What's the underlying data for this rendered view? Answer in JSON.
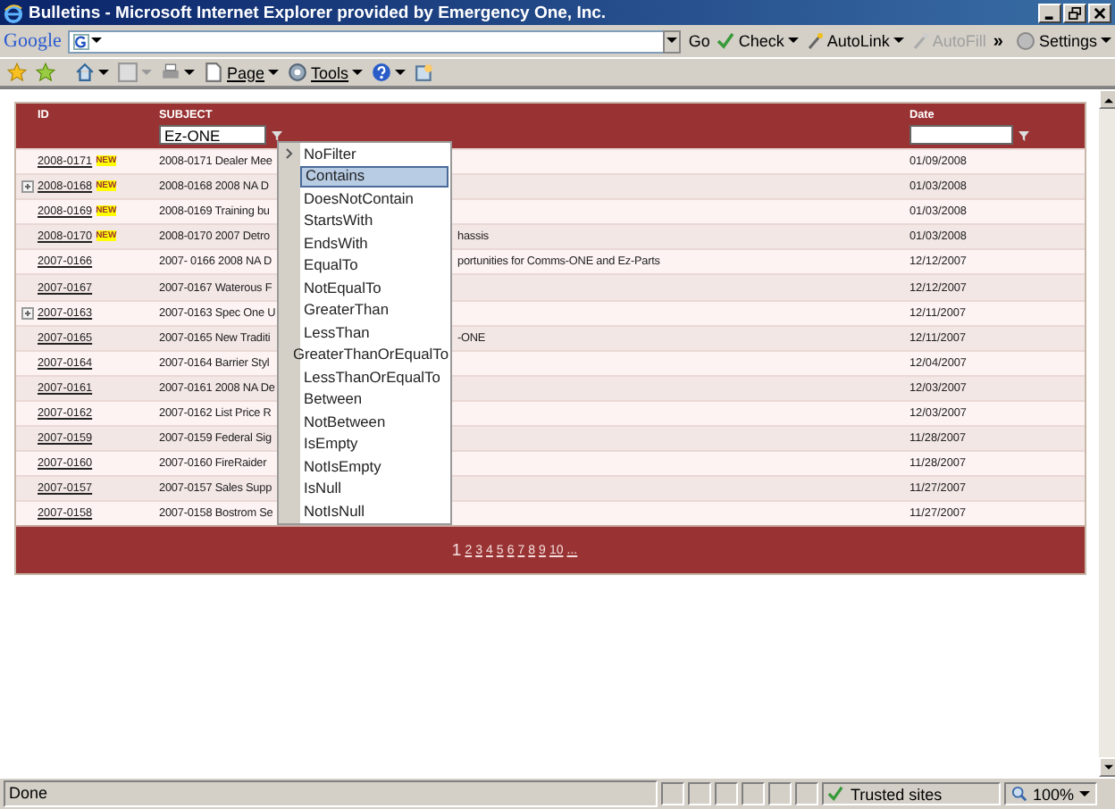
{
  "window": {
    "title": "Bulletins - Microsoft Internet Explorer provided by Emergency One, Inc."
  },
  "google_toolbar": {
    "logo": "Google",
    "go": "Go",
    "items": [
      {
        "label": "Check",
        "disabled": false,
        "dropdown": true
      },
      {
        "label": "AutoLink",
        "disabled": false,
        "dropdown": true
      },
      {
        "label": "AutoFill",
        "disabled": true,
        "dropdown": false
      }
    ],
    "more": "»",
    "settings": "Settings"
  },
  "command_bar": {
    "items": [
      {
        "label": "Page"
      },
      {
        "label": "Tools"
      }
    ]
  },
  "table": {
    "columns": [
      "ID",
      "SUBJECT",
      "Date"
    ],
    "subject_filter": "Ez-ONE",
    "rows": [
      {
        "id": "2008-0171",
        "badge": "NEW",
        "expandable": false,
        "subject": "2008-0171 Dealer Mee",
        "date": "01/09/2008"
      },
      {
        "id": "2008-0168",
        "badge": "NEW",
        "expandable": true,
        "subject": "2008-0168 2008 NA D",
        "date": "01/03/2008"
      },
      {
        "id": "2008-0169",
        "badge": "NEW",
        "expandable": false,
        "subject": "2008-0169 Training bu",
        "date": "01/03/2008"
      },
      {
        "id": "2008-0170",
        "badge": "NEW",
        "expandable": false,
        "subject": "2008-0170 2007 Detro",
        "subject_tail": "hassis",
        "date": "01/03/2008"
      },
      {
        "id": "2007-0166",
        "expandable": false,
        "subject": "2007- 0166 2008 NA D",
        "subject_tail": "portunities for Comms-ONE and Ez-Parts",
        "date": "12/12/2007"
      },
      {
        "id": "2007-0167",
        "expandable": false,
        "subject": "2007-0167 Waterous F",
        "date": "12/12/2007"
      },
      {
        "id": "2007-0163",
        "expandable": true,
        "subject": "2007-0163 Spec One U",
        "date": "12/11/2007"
      },
      {
        "id": "2007-0165",
        "expandable": false,
        "subject": "2007-0165 New Traditi",
        "subject_tail": "-ONE",
        "date": "12/11/2007"
      },
      {
        "id": "2007-0164",
        "expandable": false,
        "subject": "2007-0164 Barrier Styl",
        "date": "12/04/2007"
      },
      {
        "id": "2007-0161",
        "expandable": false,
        "subject": "2007-0161 2008 NA De",
        "date": "12/03/2007"
      },
      {
        "id": "2007-0162",
        "expandable": false,
        "subject": "2007-0162 List Price R",
        "date": "12/03/2007"
      },
      {
        "id": "2007-0159",
        "expandable": false,
        "subject": "2007-0159 Federal Sig",
        "date": "11/28/2007"
      },
      {
        "id": "2007-0160",
        "expandable": false,
        "subject": "2007-0160 FireRaider",
        "date": "11/28/2007"
      },
      {
        "id": "2007-0157",
        "expandable": false,
        "subject": "2007-0157 Sales Supp",
        "date": "11/27/2007"
      },
      {
        "id": "2007-0158",
        "expandable": false,
        "subject": "2007-0158 Bostrom Se",
        "date": "11/27/2007"
      }
    ],
    "pages": [
      {
        "label": "1",
        "selected": true
      },
      {
        "label": "2",
        "selected": false
      },
      {
        "label": "3",
        "selected": false
      },
      {
        "label": "4",
        "selected": false
      },
      {
        "label": "5",
        "selected": false
      },
      {
        "label": "6",
        "selected": false
      },
      {
        "label": "7",
        "selected": false
      },
      {
        "label": "8",
        "selected": false
      },
      {
        "label": "9",
        "selected": false
      },
      {
        "label": "10",
        "selected": false
      },
      {
        "label": "...",
        "selected": false
      }
    ]
  },
  "filter_menu": [
    {
      "label": "NoFilter",
      "selected": false,
      "current": true
    },
    {
      "label": "Contains",
      "selected": true,
      "current": false
    },
    {
      "label": "DoesNotContain",
      "selected": false,
      "current": false
    },
    {
      "label": "StartsWith",
      "selected": false,
      "current": false
    },
    {
      "label": "EndsWith",
      "selected": false,
      "current": false
    },
    {
      "label": "EqualTo",
      "selected": false,
      "current": false
    },
    {
      "label": "NotEqualTo",
      "selected": false,
      "current": false
    },
    {
      "label": "GreaterThan",
      "selected": false,
      "current": false
    },
    {
      "label": "LessThan",
      "selected": false,
      "current": false
    },
    {
      "label": "GreaterThanOrEqualTo",
      "selected": false,
      "current": false
    },
    {
      "label": "LessThanOrEqualTo",
      "selected": false,
      "current": false
    },
    {
      "label": "Between",
      "selected": false,
      "current": false
    },
    {
      "label": "NotBetween",
      "selected": false,
      "current": false
    },
    {
      "label": "IsEmpty",
      "selected": false,
      "current": false
    },
    {
      "label": "NotIsEmpty",
      "selected": false,
      "current": false
    },
    {
      "label": "IsNull",
      "selected": false,
      "current": false
    },
    {
      "label": "NotIsNull",
      "selected": false,
      "current": false
    }
  ],
  "status_bar": {
    "text": "Done",
    "zone": "Trusted sites",
    "zoom": "100%"
  }
}
